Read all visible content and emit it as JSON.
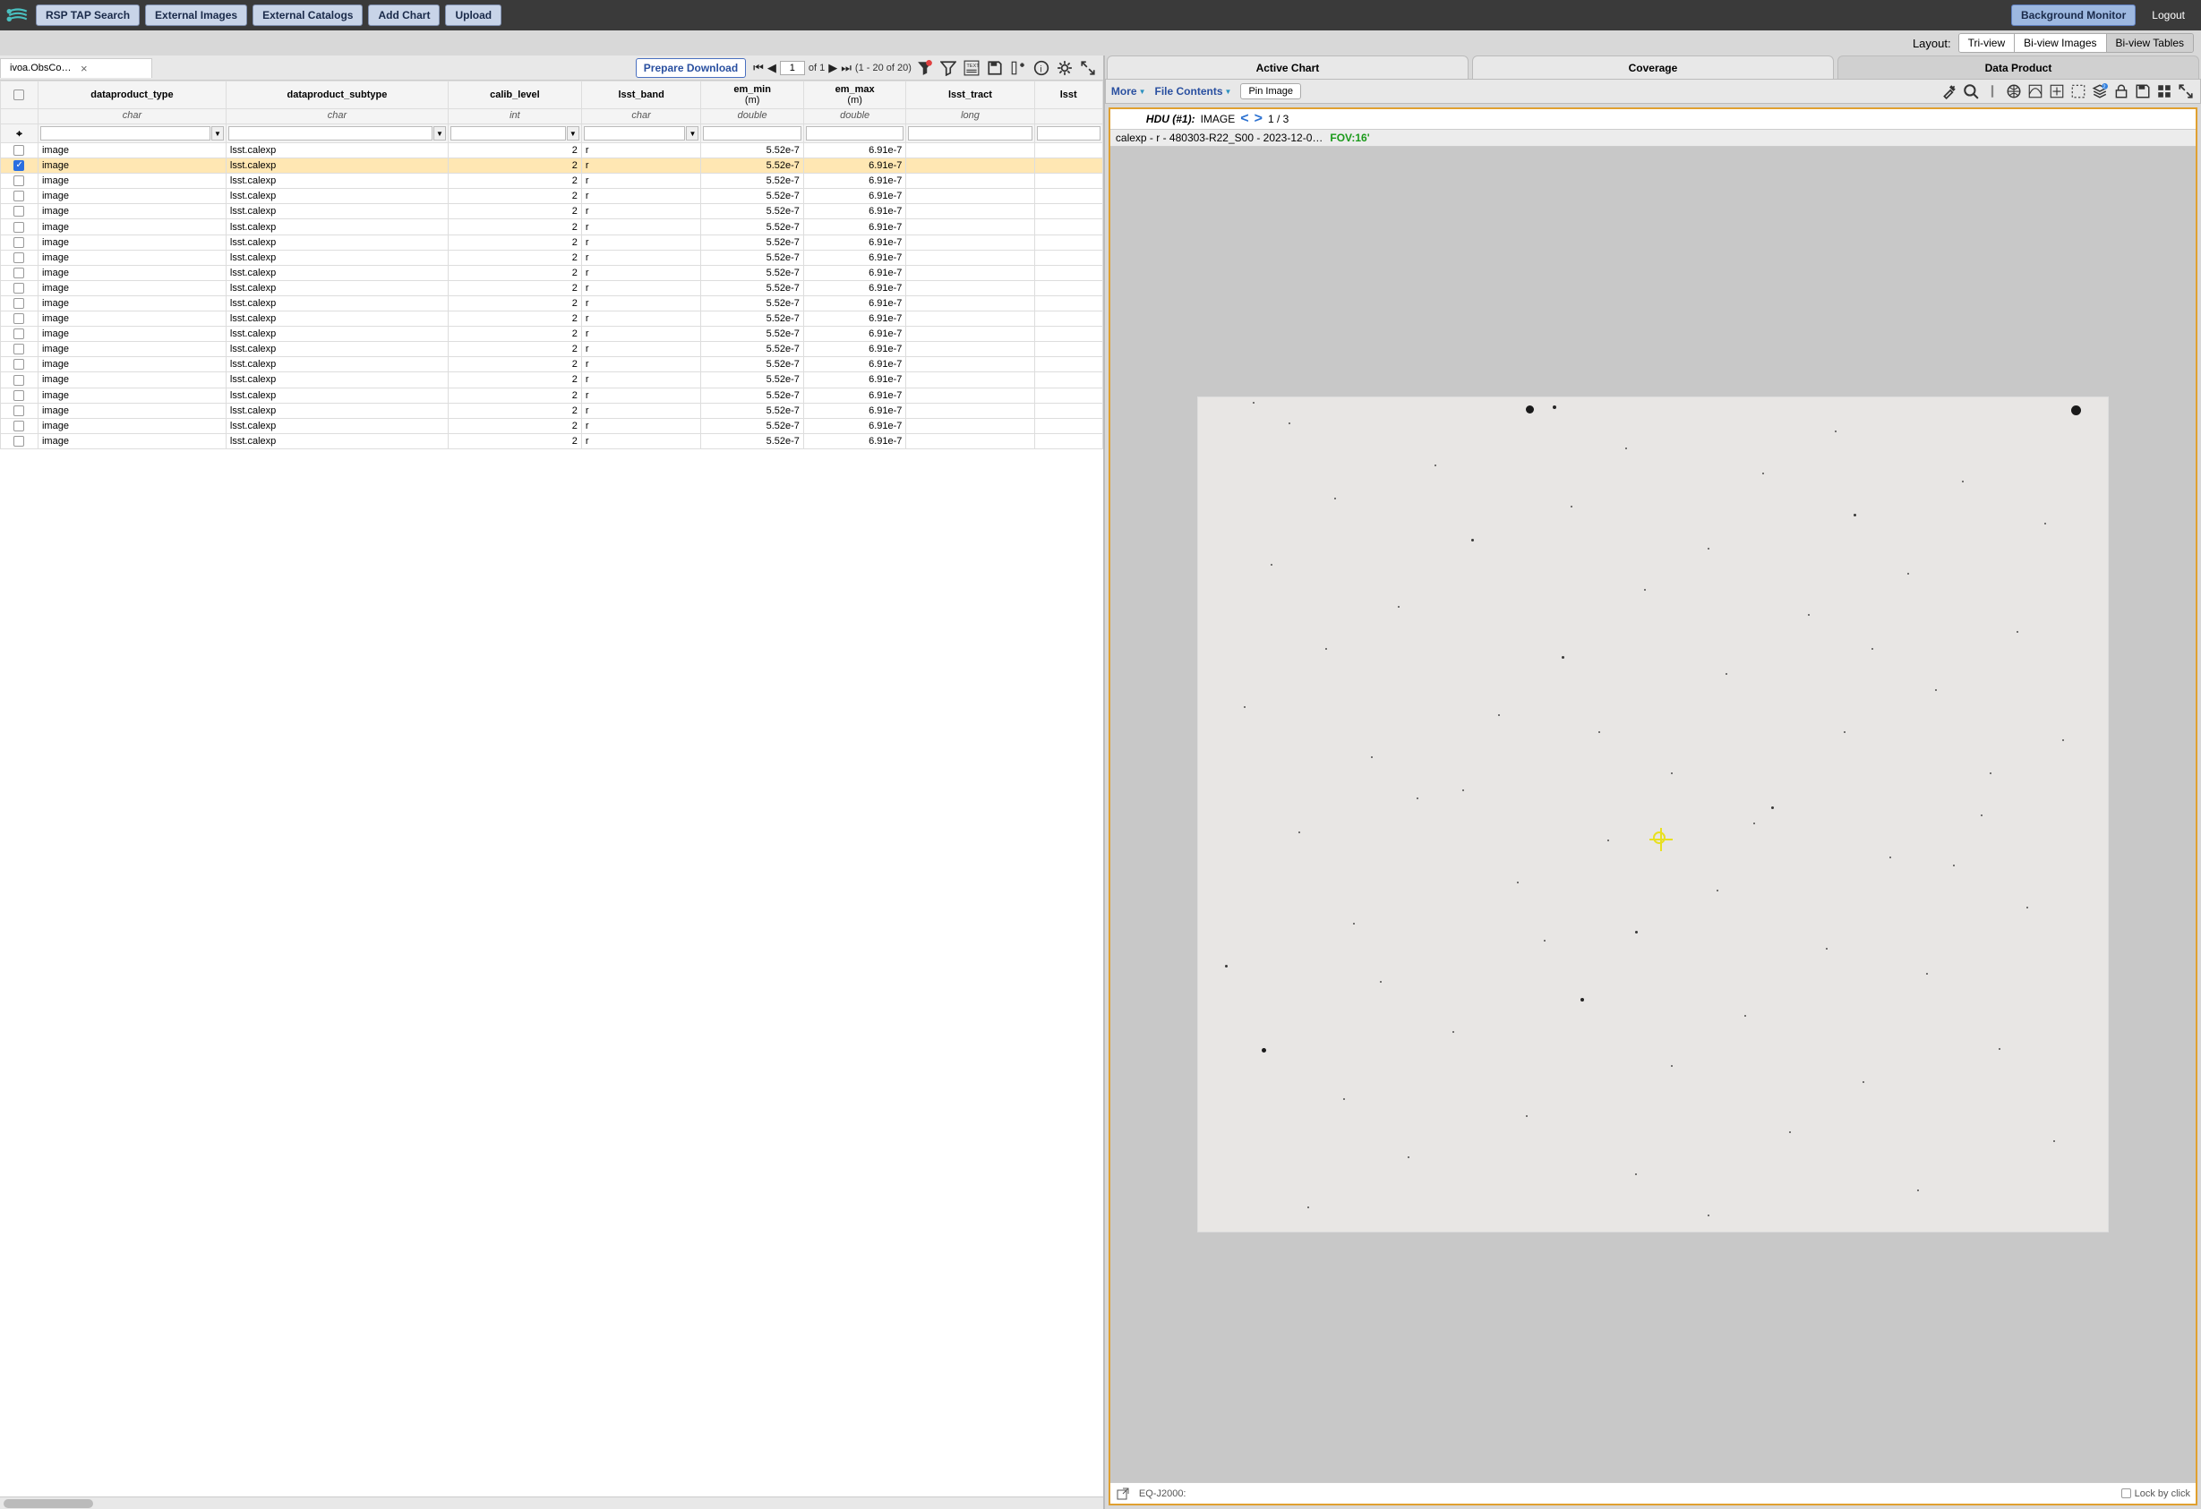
{
  "nav": {
    "buttons": [
      "RSP TAP Search",
      "External Images",
      "External Catalogs",
      "Add Chart",
      "Upload"
    ],
    "bg_monitor": "Background Monitor",
    "logout": "Logout"
  },
  "layout": {
    "label": "Layout:",
    "options": [
      "Tri-view",
      "Bi-view Images",
      "Bi-view Tables"
    ],
    "active_index": 2
  },
  "table": {
    "tab_label": "ivoa.ObsCore - data.lsst.cl...",
    "prepare_download": "Prepare Download",
    "page_value": "1",
    "page_of": "of 1",
    "range_text": "(1 - 20 of 20)",
    "columns": [
      {
        "name": "dataproduct_type",
        "type": "char",
        "w": 110,
        "dd": true,
        "align": "left"
      },
      {
        "name": "dataproduct_subtype",
        "type": "char",
        "w": 130,
        "dd": true,
        "align": "left"
      },
      {
        "name": "calib_level",
        "type": "int",
        "w": 78,
        "dd": true,
        "align": "right"
      },
      {
        "name": "lsst_band",
        "type": "char",
        "w": 70,
        "dd": true,
        "align": "left"
      },
      {
        "name": "em_min",
        "sub": "(m)",
        "type": "double",
        "w": 60,
        "align": "right"
      },
      {
        "name": "em_max",
        "sub": "(m)",
        "type": "double",
        "w": 60,
        "align": "right"
      },
      {
        "name": "lsst_tract",
        "type": "long",
        "w": 75,
        "align": "right"
      },
      {
        "name": "lsst",
        "type": "",
        "w": 40,
        "align": "left"
      }
    ],
    "row_values": {
      "dataproduct_type": "image",
      "dataproduct_subtype": "lsst.calexp",
      "calib_level": "2",
      "lsst_band": "r",
      "em_min": "5.52e-7",
      "em_max": "6.91e-7",
      "lsst_tract": "",
      "lsst": ""
    },
    "row_count": 20,
    "selected_index": 1
  },
  "right": {
    "tabs": [
      "Active Chart",
      "Coverage",
      "Data Product"
    ],
    "active_tab": 2,
    "more": "More",
    "file_contents": "File Contents",
    "pin": "Pin Image",
    "hdu_prefix": "HDU (#1):",
    "hdu_kind": "IMAGE",
    "hdu_pos": "1 / 3",
    "meta": "calexp - r - 480303-R22_S00 - 2023-12-0…",
    "fov": "FOV:16'",
    "footer_coord": "EQ-J2000:",
    "lock": "Lock by click"
  },
  "stars": [
    [
      6,
      0.5,
      2
    ],
    [
      36,
      1,
      9
    ],
    [
      39,
      1,
      4
    ],
    [
      96,
      1,
      11
    ],
    [
      10,
      3,
      2
    ],
    [
      70,
      4,
      2
    ],
    [
      47,
      6,
      2
    ],
    [
      26,
      8,
      2
    ],
    [
      62,
      9,
      2
    ],
    [
      84,
      10,
      2
    ],
    [
      15,
      12,
      2
    ],
    [
      41,
      13,
      2
    ],
    [
      72,
      14,
      3
    ],
    [
      93,
      15,
      2
    ],
    [
      30,
      17,
      3
    ],
    [
      56,
      18,
      2
    ],
    [
      8,
      20,
      2
    ],
    [
      78,
      21,
      2
    ],
    [
      49,
      23,
      2
    ],
    [
      22,
      25,
      2
    ],
    [
      67,
      26,
      2
    ],
    [
      90,
      28,
      2
    ],
    [
      14,
      30,
      2
    ],
    [
      40,
      31,
      3
    ],
    [
      58,
      33,
      2
    ],
    [
      81,
      35,
      2
    ],
    [
      5,
      37,
      2
    ],
    [
      33,
      38,
      2
    ],
    [
      71,
      40,
      2
    ],
    [
      95,
      41,
      2
    ],
    [
      19,
      43,
      2
    ],
    [
      52,
      45,
      2
    ],
    [
      24,
      48,
      2
    ],
    [
      63,
      49,
      3
    ],
    [
      86,
      50,
      2
    ],
    [
      11,
      52,
      2
    ],
    [
      45,
      53,
      2
    ],
    [
      76,
      55,
      2
    ],
    [
      35,
      58,
      2
    ],
    [
      57,
      59,
      2
    ],
    [
      91,
      61,
      2
    ],
    [
      17,
      63,
      2
    ],
    [
      48,
      64,
      3
    ],
    [
      69,
      66,
      2
    ],
    [
      3,
      68,
      3
    ],
    [
      80,
      69,
      2
    ],
    [
      42,
      72,
      4
    ],
    [
      60,
      74,
      2
    ],
    [
      28,
      76,
      2
    ],
    [
      7,
      78,
      5
    ],
    [
      88,
      78,
      2
    ],
    [
      52,
      80,
      2
    ],
    [
      73,
      82,
      2
    ],
    [
      16,
      84,
      2
    ],
    [
      36,
      86,
      2
    ],
    [
      65,
      88,
      2
    ],
    [
      94,
      89,
      2
    ],
    [
      23,
      91,
      2
    ],
    [
      48,
      93,
      2
    ],
    [
      79,
      95,
      2
    ],
    [
      12,
      97,
      2
    ],
    [
      56,
      98,
      2
    ],
    [
      83,
      56,
      2
    ],
    [
      29,
      47,
      2
    ],
    [
      74,
      30,
      2
    ],
    [
      61,
      51,
      2
    ],
    [
      44,
      40,
      2
    ],
    [
      87,
      45,
      2
    ],
    [
      20,
      70,
      2
    ],
    [
      38,
      65,
      2
    ]
  ],
  "target": [
    50,
    52
  ]
}
